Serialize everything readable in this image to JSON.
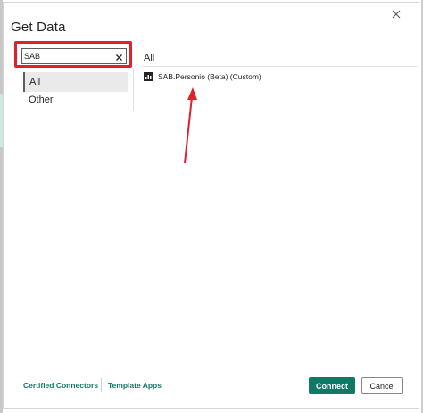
{
  "dialog": {
    "title": "Get Data"
  },
  "search": {
    "value": "SAB",
    "placeholder": ""
  },
  "categories": [
    {
      "label": "All",
      "selected": true
    },
    {
      "label": "Other",
      "selected": false
    }
  ],
  "results": {
    "header": "All",
    "items": [
      {
        "name": "SAB.Personio (Beta) (Custom)",
        "icon": "connector-icon"
      }
    ]
  },
  "footer": {
    "certified_connectors": "Certified Connectors",
    "template_apps": "Template Apps",
    "connect": "Connect",
    "cancel": "Cancel"
  },
  "colors": {
    "accent": "#117865",
    "annotation": "#e0202a"
  }
}
